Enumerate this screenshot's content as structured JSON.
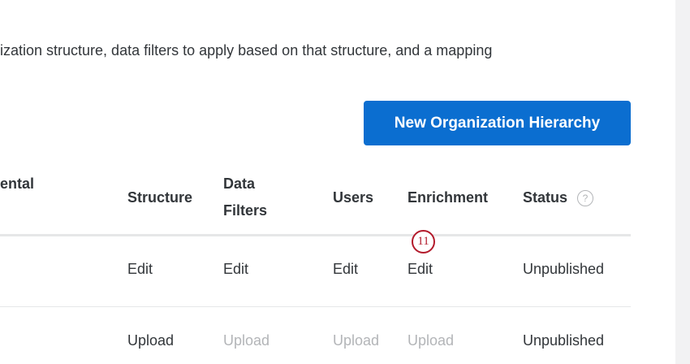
{
  "description": "ization structure, data filters to apply based on that structure, and a mapping",
  "new_button": "New Organization Hierarchy",
  "columns": {
    "partial": "ental",
    "structure": "Structure",
    "data_filters_1": "Data",
    "data_filters_2": "Filters",
    "users": "Users",
    "enrichment": "Enrichment",
    "status": "Status",
    "help": "?"
  },
  "rows": [
    {
      "structure": "Edit",
      "data_filters": "Edit",
      "users": "Edit",
      "enrichment": "Edit",
      "status": "Unpublished"
    },
    {
      "structure": "Upload",
      "data_filters": "Upload",
      "users": "Upload",
      "enrichment": "Upload",
      "status": "Unpublished"
    }
  ],
  "annotation": "11"
}
